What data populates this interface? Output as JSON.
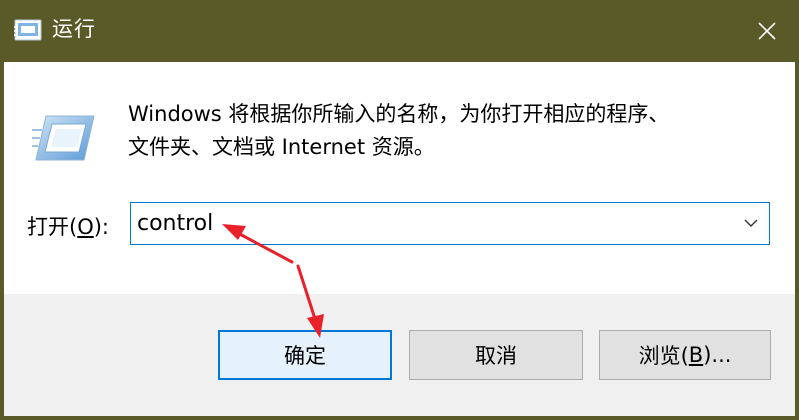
{
  "window": {
    "title": "运行",
    "title_icon": "run-app-icon",
    "close_icon": "close-icon"
  },
  "description": {
    "line1": "Windows 将根据你所输入的名称，为你打开相应的程序、",
    "line2": "文件夹、文档或 Internet 资源。"
  },
  "open_field": {
    "label_prefix": "打开(",
    "label_access_key": "O",
    "label_suffix": "):",
    "value": "control",
    "dropdown_icon": "chevron-down-icon"
  },
  "buttons": {
    "ok_label": "确定",
    "cancel_label": "取消",
    "browse_prefix": "浏览(",
    "browse_access_key": "B",
    "browse_suffix": ")..."
  },
  "colors": {
    "titlebar": "#5a5a28",
    "accent": "#0078d7",
    "footer": "#f0f0f0",
    "annotation_arrow": "#e8212b"
  }
}
